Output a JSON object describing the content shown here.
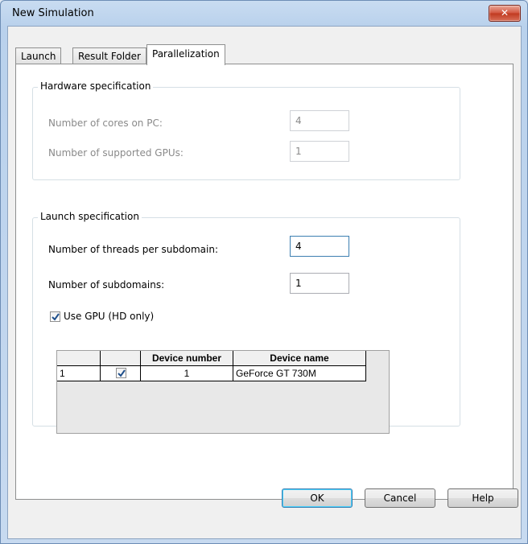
{
  "window": {
    "title": "New Simulation",
    "close_label": "✕"
  },
  "tabs": [
    {
      "label": "Launch"
    },
    {
      "label": "Result Folder"
    },
    {
      "label": "Parallelization"
    }
  ],
  "hardware": {
    "title": "Hardware specification",
    "cores_label": "Number of cores on PC:",
    "cores_value": "4",
    "gpus_label": "Number of supported GPUs:",
    "gpus_value": "1"
  },
  "launch": {
    "title": "Launch specification",
    "threads_label": "Number of threads per subdomain:",
    "threads_value": "4",
    "subdomains_label": "Number of subdomains:",
    "subdomains_value": "1",
    "use_gpu_label": "Use GPU (HD only)",
    "use_gpu_checked": true
  },
  "device_table": {
    "headers": [
      "",
      "",
      "Device number",
      "Device name"
    ],
    "rows": [
      {
        "index": "1",
        "selected": true,
        "device_number": "1",
        "device_name": "GeForce GT 730M"
      }
    ]
  },
  "buttons": {
    "ok": "OK",
    "cancel": "Cancel",
    "help": "Help"
  },
  "colors": {
    "title_bar": "#c9dcf1",
    "close_button": "#c0391f",
    "focus_border": "#3c7fb1",
    "checkmark": "#1f4f8b"
  }
}
